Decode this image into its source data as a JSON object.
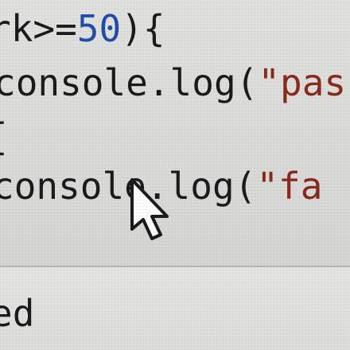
{
  "editor": {
    "lines": [
      {
        "parts": [
          {
            "text": "rk>=",
            "kind": "code"
          },
          {
            "text": "50",
            "kind": "num"
          },
          {
            "text": "){",
            "kind": "code"
          }
        ]
      },
      {
        "parts": [
          {
            "text": "console.log(",
            "kind": "code"
          },
          {
            "text": "\"pas",
            "kind": "str"
          }
        ]
      },
      {
        "parts": [
          {
            "text": "{",
            "kind": "code"
          }
        ]
      },
      {
        "parts": [
          {
            "text": "console.log(",
            "kind": "code"
          },
          {
            "text": "\"fa",
            "kind": "str"
          }
        ]
      }
    ]
  },
  "output": {
    "text": "ed"
  },
  "cursor": {
    "icon": "mouse-pointer-icon"
  },
  "colors": {
    "background": "#dcdcda",
    "code_text": "#1b1b1b",
    "number": "#1f4fa8",
    "string": "#8a2a1c"
  }
}
